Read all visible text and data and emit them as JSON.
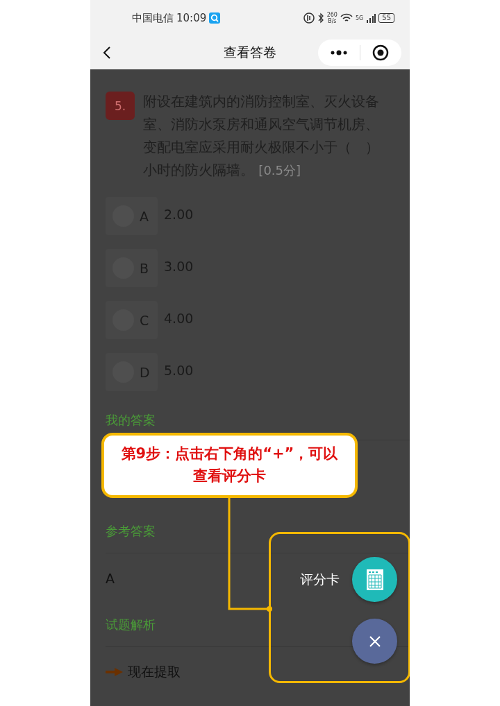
{
  "status_bar": {
    "carrier": "中国电信",
    "time": "10:09",
    "speed": "260",
    "speed_unit": "B/s",
    "network": "5G",
    "battery": "55"
  },
  "nav": {
    "title": "查看答卷"
  },
  "question": {
    "number": "5.",
    "text": "附设在建筑内的消防控制室、灭火设备室、消防水泵房和通风空气调节机房、变配电室应采用耐火极限不小于（　）小时的防火隔墙。",
    "score": "[0.5分]"
  },
  "options": [
    {
      "letter": "A",
      "value": "2.00",
      "selected": false
    },
    {
      "letter": "B",
      "value": "3.00",
      "selected": false
    },
    {
      "letter": "C",
      "value": "4.00",
      "selected": false
    },
    {
      "letter": "D",
      "value": "5.00",
      "selected": false
    }
  ],
  "my_answer": {
    "label": "我的答案"
  },
  "reference": {
    "label": "参考答案",
    "answer": "A"
  },
  "analysis": {
    "label": "试题解析",
    "link": "现在提取"
  },
  "fab": {
    "label": "评分卡"
  },
  "callout": {
    "text": "第9步：点击右下角的“+”，可以查看评分卡"
  }
}
